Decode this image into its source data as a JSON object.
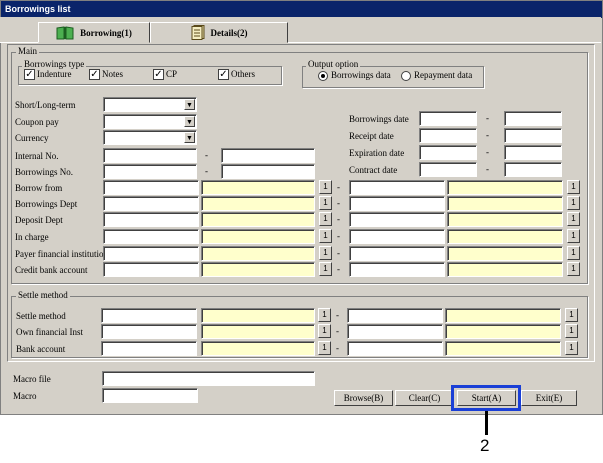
{
  "window": {
    "title": "Borrowings list"
  },
  "tabs": [
    {
      "label": "Borrowing(1)",
      "icon": "book-icon"
    },
    {
      "label": "Details(2)",
      "icon": "document-icon"
    }
  ],
  "main": {
    "group_label": "Main",
    "borrowings_type": {
      "label": "Borrowings type",
      "options": [
        {
          "label": "Indenture",
          "checked": true
        },
        {
          "label": "Notes",
          "checked": true
        },
        {
          "label": "CP",
          "checked": true
        },
        {
          "label": "Others",
          "checked": true
        }
      ]
    },
    "output_option": {
      "label": "Output option",
      "options": [
        {
          "label": "Borrowings data",
          "selected": true
        },
        {
          "label": "Repayment data",
          "selected": false
        }
      ]
    },
    "left_fields": [
      {
        "label": "Short/Long-term"
      },
      {
        "label": "Coupon pay"
      },
      {
        "label": "Currency"
      },
      {
        "label": "Internal No."
      },
      {
        "label": "Borrowings No."
      }
    ],
    "date_fields": [
      {
        "label": "Borrowings date"
      },
      {
        "label": "Receipt date"
      },
      {
        "label": "Expiration date"
      },
      {
        "label": "Contract date"
      }
    ],
    "range_fields": [
      {
        "label": "Borrow from"
      },
      {
        "label": "Borrowings Dept"
      },
      {
        "label": "Deposit Dept"
      },
      {
        "label": "In charge"
      },
      {
        "label": "Payer financial institution"
      },
      {
        "label": "Credit bank account"
      }
    ],
    "range_sep": "-",
    "search_btn": "1"
  },
  "settle": {
    "group_label": "Settle method",
    "fields": [
      {
        "label": "Settle method"
      },
      {
        "label": "Own financial Inst"
      },
      {
        "label": "Bank account"
      }
    ]
  },
  "macro": {
    "file_label": "Macro file",
    "macro_label": "Macro"
  },
  "buttons": {
    "browse": "Browse(B)",
    "clear": "Clear(C)",
    "start": "Start(A)",
    "exit": "Exit(E)"
  },
  "annotation": {
    "step": "2"
  }
}
